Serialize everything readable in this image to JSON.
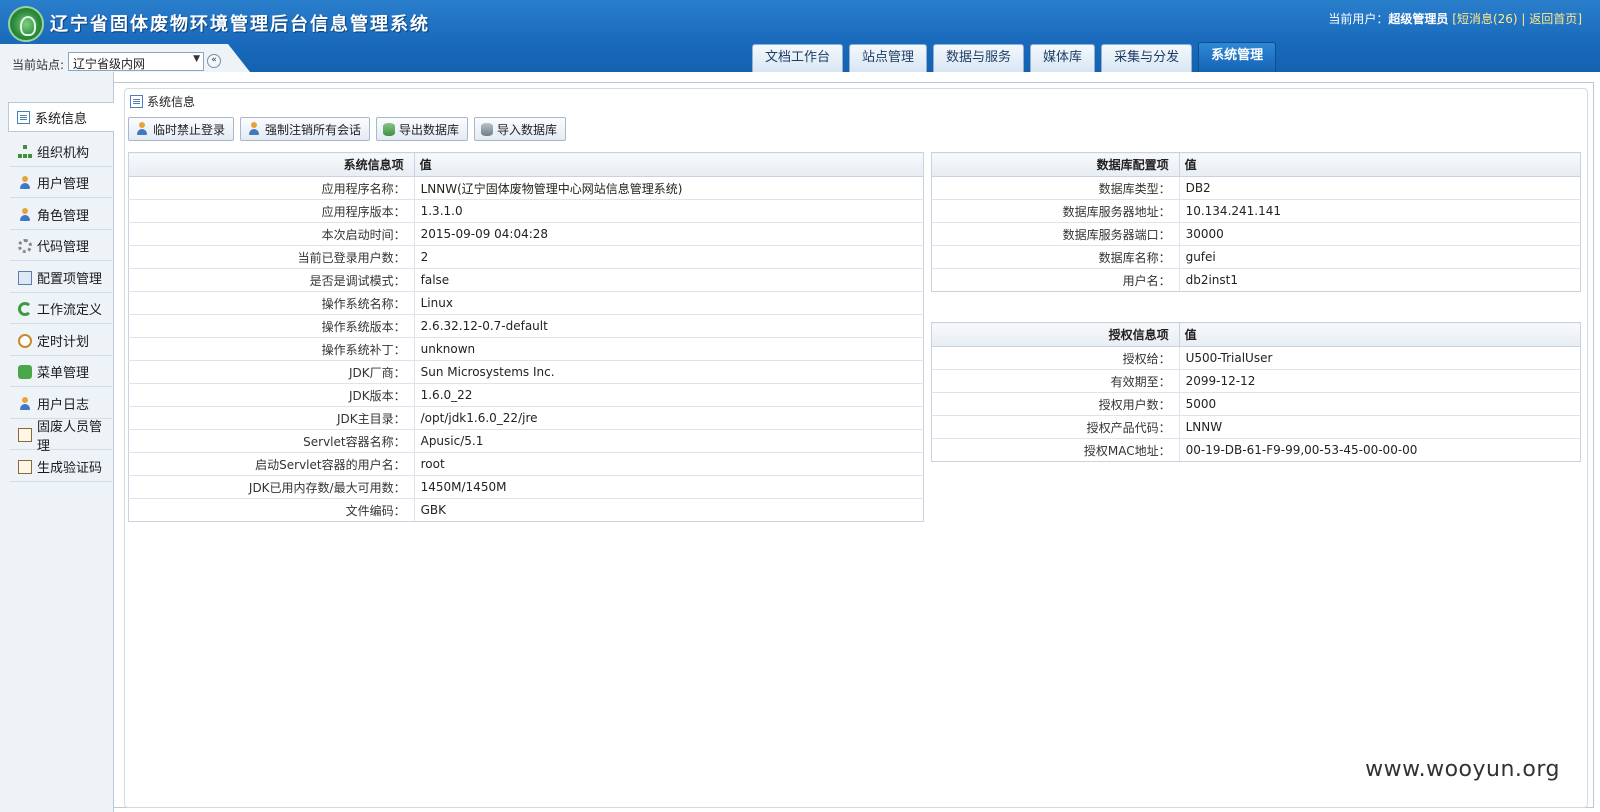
{
  "app": {
    "title": "辽宁省固体废物环境管理后台信息管理系统"
  },
  "userbar": {
    "prefix": "当前用户：",
    "username": "超级管理员",
    "open_bracket": "[",
    "messages": "短消息(26)",
    "divider": "|",
    "home": "返回首页",
    "close_bracket": "]"
  },
  "site": {
    "label": "当前站点:",
    "selected": "辽宁省级内网"
  },
  "tabs": [
    {
      "label": "文档工作台"
    },
    {
      "label": "站点管理"
    },
    {
      "label": "数据与服务"
    },
    {
      "label": "媒体库"
    },
    {
      "label": "采集与分发"
    },
    {
      "label": "系统管理",
      "active": true
    }
  ],
  "sidebar": {
    "items": [
      {
        "label": "系统信息",
        "icon": "doc-icon",
        "active": true
      },
      {
        "label": "组织机构",
        "icon": "tree-icon"
      },
      {
        "label": "用户管理",
        "icon": "user-icon"
      },
      {
        "label": "角色管理",
        "icon": "users-icon"
      },
      {
        "label": "代码管理",
        "icon": "gear-icon"
      },
      {
        "label": "配置项管理",
        "icon": "config-icon"
      },
      {
        "label": "工作流定义",
        "icon": "workflow-icon"
      },
      {
        "label": "定时计划",
        "icon": "clock-icon"
      },
      {
        "label": "菜单管理",
        "icon": "puzzle-icon"
      },
      {
        "label": "用户日志",
        "icon": "log-icon"
      },
      {
        "label": "固废人员管理",
        "icon": "staff-icon"
      },
      {
        "label": "生成验证码",
        "icon": "captcha-icon"
      }
    ]
  },
  "panel": {
    "title": "系统信息"
  },
  "toolbar": {
    "buttons": [
      {
        "label": "临时禁止登录",
        "icon": "user-lock-icon"
      },
      {
        "label": "强制注销所有会话",
        "icon": "user-logout-icon"
      },
      {
        "label": "导出数据库",
        "icon": "db-export-icon"
      },
      {
        "label": "导入数据库",
        "icon": "db-import-icon"
      }
    ]
  },
  "system_info": {
    "header_key": "系统信息项",
    "header_value": "值",
    "rows": [
      {
        "k": "应用程序名称：",
        "v": "LNNW(辽宁固体废物管理中心网站信息管理系统)"
      },
      {
        "k": "应用程序版本：",
        "v": "1.3.1.0"
      },
      {
        "k": "本次启动时间：",
        "v": "2015-09-09 04:04:28"
      },
      {
        "k": "当前已登录用户数：",
        "v": "2"
      },
      {
        "k": "是否是调试模式：",
        "v": "false"
      },
      {
        "k": "操作系统名称：",
        "v": "Linux"
      },
      {
        "k": "操作系统版本：",
        "v": "2.6.32.12-0.7-default"
      },
      {
        "k": "操作系统补丁：",
        "v": "unknown"
      },
      {
        "k": "JDK厂商：",
        "v": "Sun Microsystems Inc."
      },
      {
        "k": "JDK版本：",
        "v": "1.6.0_22"
      },
      {
        "k": "JDK主目录：",
        "v": "/opt/jdk1.6.0_22/jre"
      },
      {
        "k": "Servlet容器名称：",
        "v": "Apusic/5.1"
      },
      {
        "k": "启动Servlet容器的用户名：",
        "v": "root"
      },
      {
        "k": "JDK已用内存数/最大可用数：",
        "v": "1450M/1450M"
      },
      {
        "k": "文件编码：",
        "v": "GBK"
      }
    ]
  },
  "db_config": {
    "header_key": "数据库配置项",
    "header_value": "值",
    "rows": [
      {
        "k": "数据库类型：",
        "v": "DB2"
      },
      {
        "k": "数据库服务器地址：",
        "v": "10.134.241.141"
      },
      {
        "k": "数据库服务器端口：",
        "v": "30000"
      },
      {
        "k": "数据库名称：",
        "v": "gufei"
      },
      {
        "k": "用户名：",
        "v": "db2inst1"
      }
    ]
  },
  "license": {
    "header_key": "授权信息项",
    "header_value": "值",
    "rows": [
      {
        "k": "授权给：",
        "v": "U500-TrialUser"
      },
      {
        "k": "有效期至：",
        "v": "2099-12-12"
      },
      {
        "k": "授权用户数：",
        "v": "5000"
      },
      {
        "k": "授权产品代码：",
        "v": "LNNW"
      },
      {
        "k": "授权MAC地址：",
        "v": "00-19-DB-61-F9-99,00-53-45-00-00-00"
      }
    ]
  },
  "watermark": "www.wooyun.org"
}
